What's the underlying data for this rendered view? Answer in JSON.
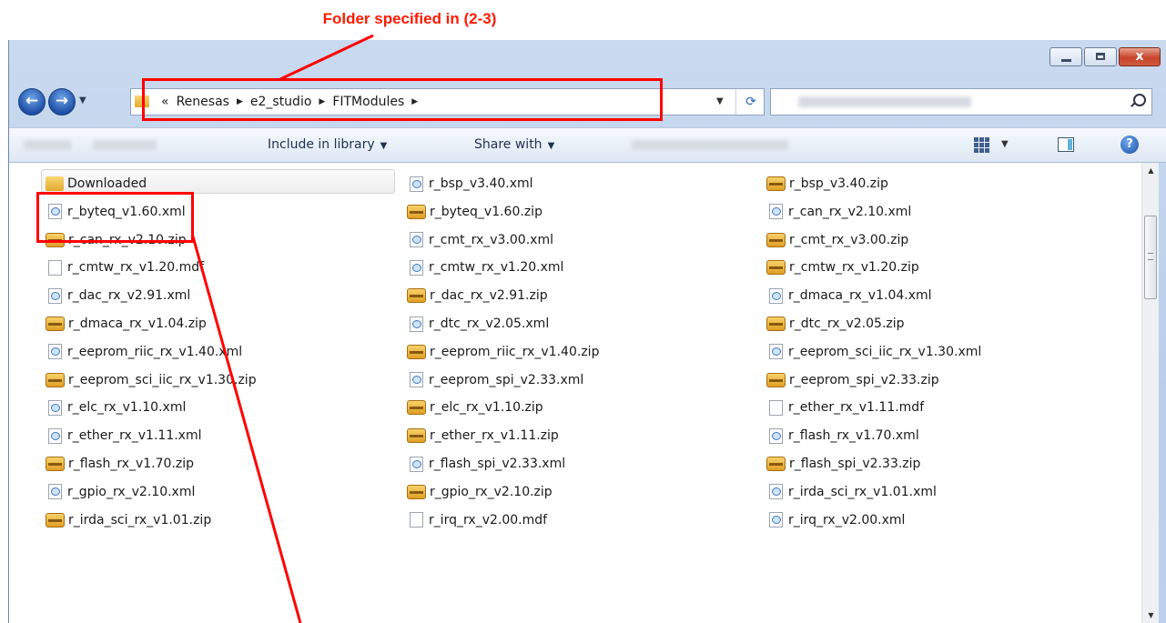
{
  "annotation": {
    "caption": "Folder specified in (2-3)"
  },
  "window": {
    "buttons": {
      "close_glyph": "x"
    }
  },
  "navigation": {
    "back_icon": "back-arrow-icon",
    "forward_icon": "forward-arrow-icon",
    "address": {
      "overflow": "«",
      "crumbs": [
        "Renesas",
        "e2_studio",
        "FITModules"
      ]
    }
  },
  "toolbar": {
    "include_in_library": "Include in library",
    "share_with": "Share with"
  },
  "files": [
    {
      "name": "Downloaded",
      "type": "folder"
    },
    {
      "name": "r_bsp_v3.40.xml",
      "type": "xml"
    },
    {
      "name": "r_bsp_v3.40.zip",
      "type": "zip"
    },
    {
      "name": "r_byteq_v1.60.xml",
      "type": "xml"
    },
    {
      "name": "r_byteq_v1.60.zip",
      "type": "zip"
    },
    {
      "name": "r_can_rx_v2.10.xml",
      "type": "xml"
    },
    {
      "name": "r_can_rx_v2.10.zip",
      "type": "zip"
    },
    {
      "name": "r_cmt_rx_v3.00.xml",
      "type": "xml"
    },
    {
      "name": "r_cmt_rx_v3.00.zip",
      "type": "zip"
    },
    {
      "name": "r_cmtw_rx_v1.20.mdf",
      "type": "mdf"
    },
    {
      "name": "r_cmtw_rx_v1.20.xml",
      "type": "xml"
    },
    {
      "name": "r_cmtw_rx_v1.20.zip",
      "type": "zip"
    },
    {
      "name": "r_dac_rx_v2.91.xml",
      "type": "xml"
    },
    {
      "name": "r_dac_rx_v2.91.zip",
      "type": "zip"
    },
    {
      "name": "r_dmaca_rx_v1.04.xml",
      "type": "xml"
    },
    {
      "name": "r_dmaca_rx_v1.04.zip",
      "type": "zip"
    },
    {
      "name": "r_dtc_rx_v2.05.xml",
      "type": "xml"
    },
    {
      "name": "r_dtc_rx_v2.05.zip",
      "type": "zip"
    },
    {
      "name": "r_eeprom_riic_rx_v1.40.xml",
      "type": "xml"
    },
    {
      "name": "r_eeprom_riic_rx_v1.40.zip",
      "type": "zip"
    },
    {
      "name": "r_eeprom_sci_iic_rx_v1.30.xml",
      "type": "xml"
    },
    {
      "name": "r_eeprom_sci_iic_rx_v1.30.zip",
      "type": "zip"
    },
    {
      "name": "r_eeprom_spi_v2.33.xml",
      "type": "xml"
    },
    {
      "name": "r_eeprom_spi_v2.33.zip",
      "type": "zip"
    },
    {
      "name": "r_elc_rx_v1.10.xml",
      "type": "xml"
    },
    {
      "name": "r_elc_rx_v1.10.zip",
      "type": "zip"
    },
    {
      "name": "r_ether_rx_v1.11.mdf",
      "type": "mdf"
    },
    {
      "name": "r_ether_rx_v1.11.xml",
      "type": "xml"
    },
    {
      "name": "r_ether_rx_v1.11.zip",
      "type": "zip"
    },
    {
      "name": "r_flash_rx_v1.70.xml",
      "type": "xml"
    },
    {
      "name": "r_flash_rx_v1.70.zip",
      "type": "zip"
    },
    {
      "name": "r_flash_spi_v2.33.xml",
      "type": "xml"
    },
    {
      "name": "r_flash_spi_v2.33.zip",
      "type": "zip"
    },
    {
      "name": "r_gpio_rx_v2.10.xml",
      "type": "xml"
    },
    {
      "name": "r_gpio_rx_v2.10.zip",
      "type": "zip"
    },
    {
      "name": "r_irda_sci_rx_v1.01.xml",
      "type": "xml"
    },
    {
      "name": "r_irda_sci_rx_v1.01.zip",
      "type": "zip"
    },
    {
      "name": "r_irq_rx_v2.00.mdf",
      "type": "mdf"
    },
    {
      "name": "r_irq_rx_v2.00.xml",
      "type": "xml"
    }
  ]
}
